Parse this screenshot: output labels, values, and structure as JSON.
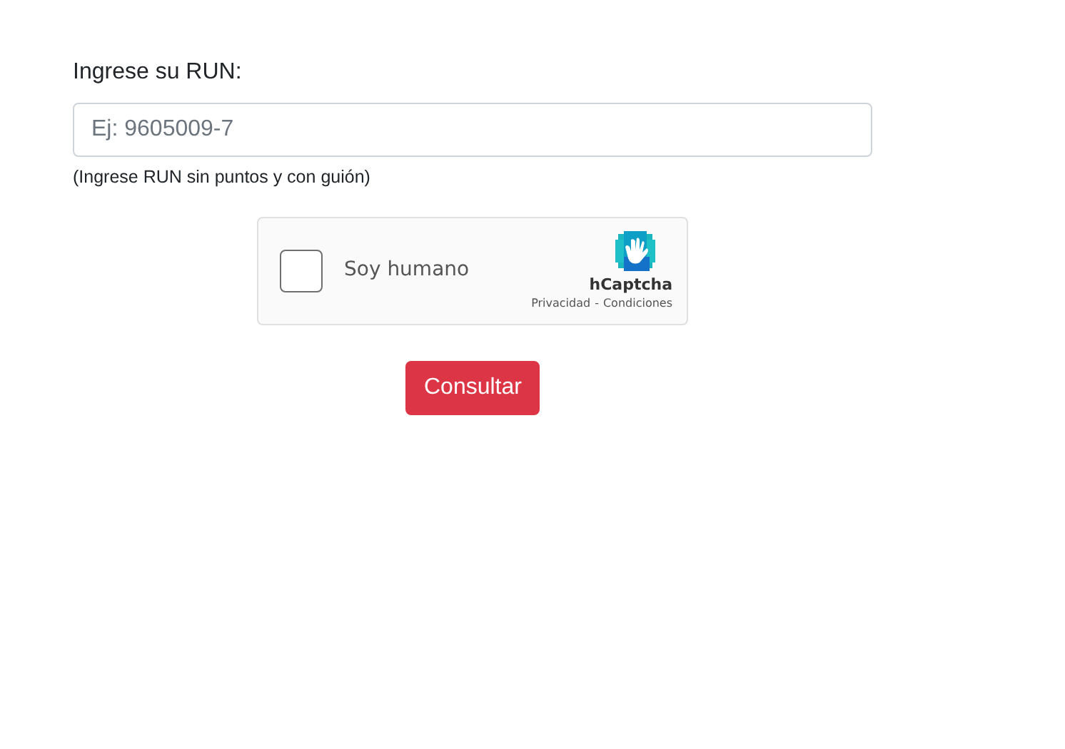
{
  "run_field": {
    "label": "Ingrese su RUN:",
    "placeholder": "Ej: 9605009-7",
    "help": "(Ingrese RUN sin puntos y con guión)"
  },
  "captcha": {
    "checked": false,
    "label": "Soy humano",
    "brand": "hCaptcha",
    "privacy_link": "Privacidad",
    "separator": "-",
    "terms_link": "Condiciones"
  },
  "submit_button": "Consultar"
}
